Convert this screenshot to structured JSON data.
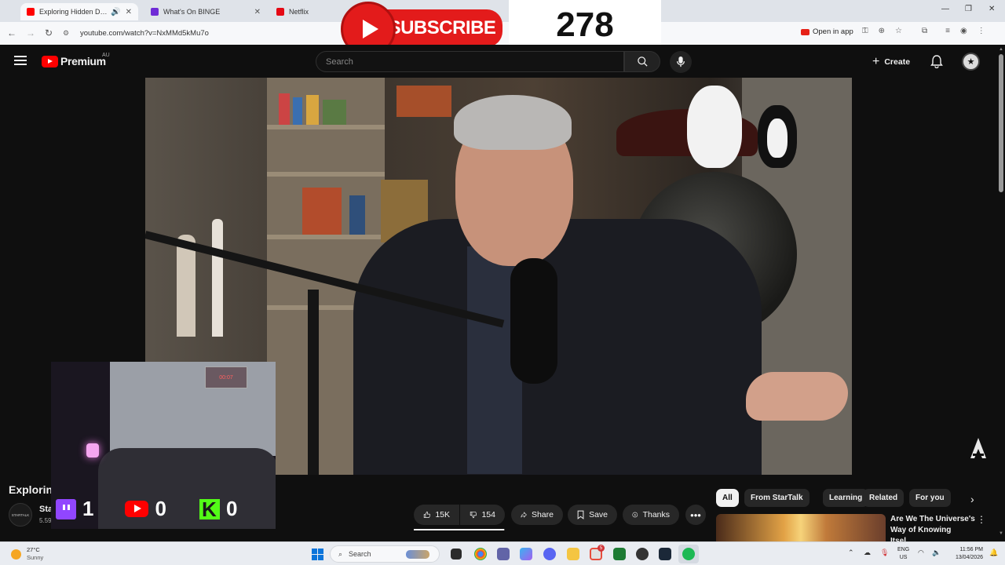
{
  "browser": {
    "tabs": [
      {
        "title": "Exploring Hidden Dimensio",
        "favicon_color": "#ff0000",
        "active": true
      },
      {
        "title": "What's On BINGE",
        "favicon_color": "#6f2bd6",
        "active": false
      },
      {
        "title": "Netflix",
        "favicon_color": "#e50914",
        "active": false
      }
    ],
    "url": "youtube.com/watch?v=NxMMd5kMu7o",
    "open_in_app": "Open in app"
  },
  "youtube": {
    "logo_text": "Premium",
    "country_code": "AU",
    "search_placeholder": "Search",
    "create_label": "Create"
  },
  "overlay": {
    "subscribe_label": "SUBSCRIBE",
    "subscriber_count": "278",
    "twitch_count": "1",
    "youtube_count": "0",
    "kick_count": "0",
    "webcam_clock": "00:07"
  },
  "video": {
    "title_visible": "Exploring",
    "channel_name": "Sta",
    "channel_subs": "5.59",
    "channel_avatar_text": "STARTALK"
  },
  "actions": {
    "likes": "15K",
    "like_fraction": 0.99,
    "dislikes": "154",
    "share": "Share",
    "save": "Save",
    "thanks": "Thanks"
  },
  "chips": [
    "All",
    "From StarTalk",
    "Learning",
    "Related",
    "For you"
  ],
  "recommendation": {
    "title": "Are We The Universe's Way of Knowing Itsel..."
  },
  "taskbar": {
    "temperature": "27°C",
    "weather": "Sunny",
    "search_label": "Search",
    "lang_top": "ENG",
    "lang_bottom": "US",
    "time": "11:56 PM",
    "date": "13/04/2026",
    "chrome_badge": "5"
  },
  "colors": {
    "youtube_red": "#ff0000",
    "twitch_purple": "#9146ff",
    "kick_green": "#53fc18",
    "background": "#0f0f0f"
  }
}
